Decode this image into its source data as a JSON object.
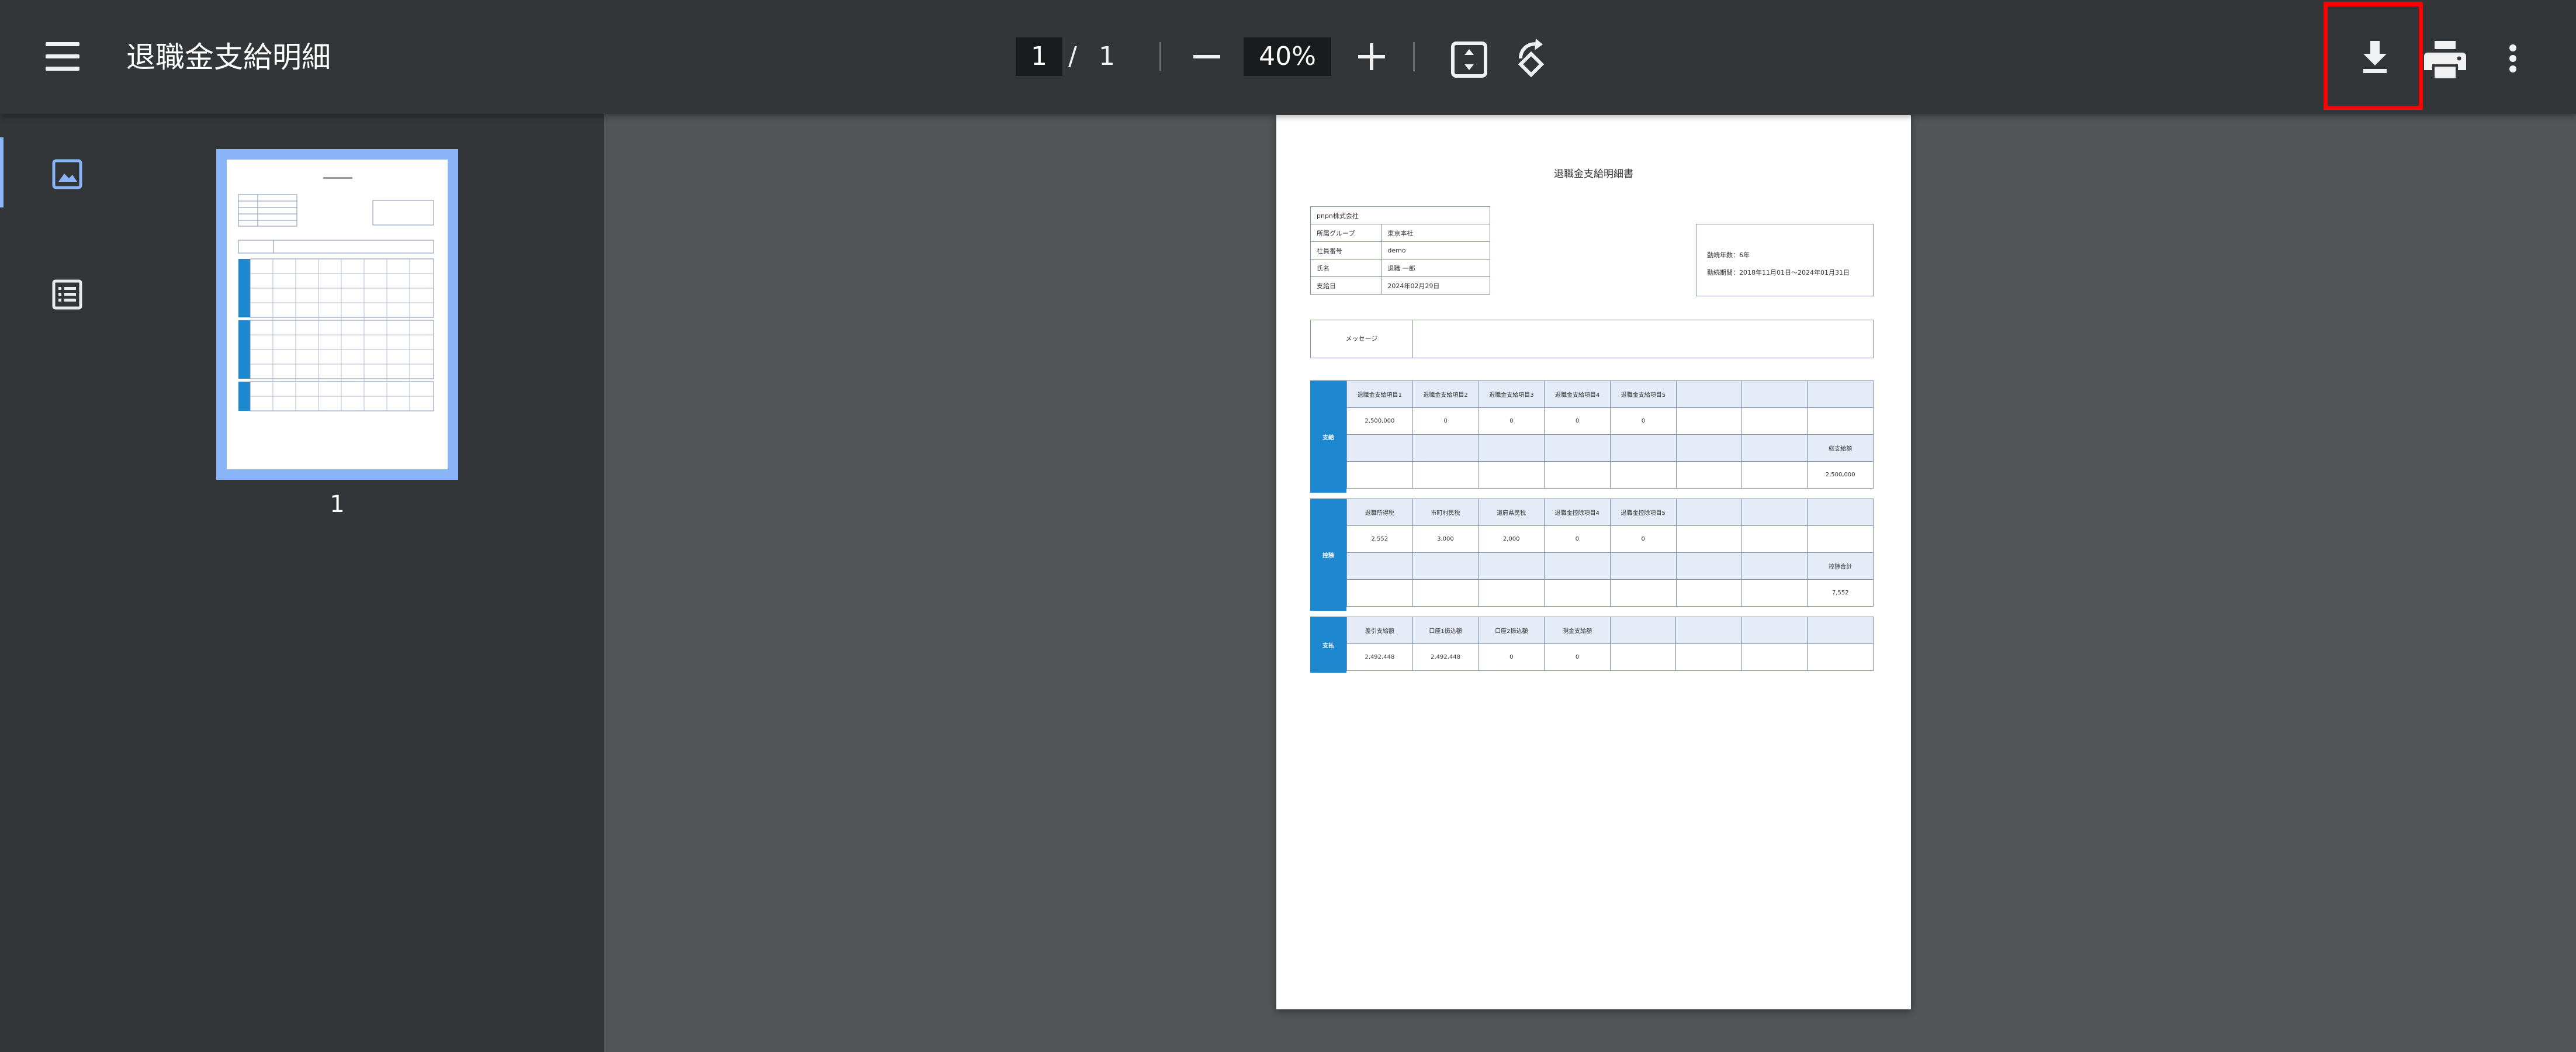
{
  "toolbar": {
    "title": "退職金支給明細",
    "page_current": "1",
    "page_separator": "/",
    "page_total": "1",
    "zoom": "40%",
    "highlight_color": "#ff0000"
  },
  "icons": [
    "menu-icon",
    "minus-icon",
    "plus-icon",
    "fit-page-icon",
    "rotate-icon",
    "download-icon",
    "print-icon",
    "more-vert-icon",
    "thumbnail-icon",
    "outline-icon"
  ],
  "sidebar": {
    "thumbnail_label": "1"
  },
  "document": {
    "title": "退職金支給明細書",
    "company": "pnpn株式会社",
    "info_rows": [
      {
        "label": "所属グループ",
        "value": "東京本社"
      },
      {
        "label": "社員番号",
        "value": "demo"
      },
      {
        "label": "氏名",
        "value": "退職 一郎"
      },
      {
        "label": "支給日",
        "value": "2024年02月29日"
      }
    ],
    "years_worked": "勤続年数：6年",
    "period": "勤続期間：2018年11月01日～2024年01月31日",
    "message_label": "メッセージ",
    "sections": [
      {
        "label": "支給",
        "rows": [
          [
            "退職金支給項目1",
            "退職金支給項目2",
            "退職金支給項目3",
            "退職金支給項目4",
            "退職金支給項目5",
            "",
            "",
            ""
          ],
          [
            "2,500,000",
            "0",
            "0",
            "0",
            "0",
            "",
            "",
            ""
          ],
          [
            "",
            "",
            "",
            "",
            "",
            "",
            "",
            "総支給額"
          ],
          [
            "",
            "",
            "",
            "",
            "",
            "",
            "",
            "2,500,000"
          ]
        ]
      },
      {
        "label": "控除",
        "rows": [
          [
            "退職所得税",
            "市町村民税",
            "道府県民税",
            "退職金控除項目4",
            "退職金控除項目5",
            "",
            "",
            ""
          ],
          [
            "2,552",
            "3,000",
            "2,000",
            "0",
            "0",
            "",
            "",
            ""
          ],
          [
            "",
            "",
            "",
            "",
            "",
            "",
            "",
            "控除合計"
          ],
          [
            "",
            "",
            "",
            "",
            "",
            "",
            "",
            "7,552"
          ]
        ]
      },
      {
        "label": "支払",
        "rows": [
          [
            "差引支給額",
            "口座1振込額",
            "口座2振込額",
            "現金支給額",
            "",
            "",
            "",
            ""
          ],
          [
            "2,492,448",
            "2,492,448",
            "0",
            "0",
            "",
            "",
            "",
            ""
          ]
        ]
      }
    ]
  }
}
